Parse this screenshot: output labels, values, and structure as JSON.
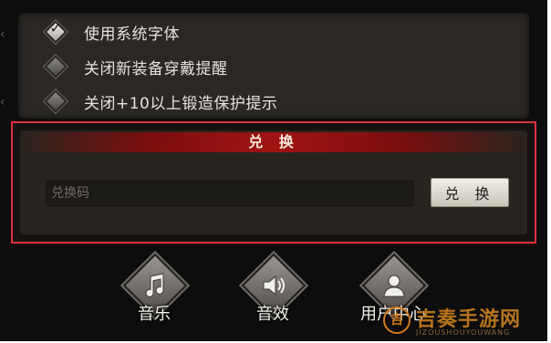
{
  "options": [
    {
      "label": "使用系统字体",
      "checked": true
    },
    {
      "label": "关闭新装备穿戴提醒",
      "checked": false
    },
    {
      "label": "关闭+10以上锻造保护提示",
      "checked": false
    }
  ],
  "redeem": {
    "title": "兑 换",
    "placeholder": "兑换码",
    "button_label": "兑 换",
    "highlight_color": "#e0313f"
  },
  "bottom_menu": [
    {
      "label": "音乐",
      "icon": "music-icon"
    },
    {
      "label": "音效",
      "icon": "speaker-icon"
    },
    {
      "label": "用户中心",
      "icon": "user-icon"
    }
  ],
  "watermark": {
    "text": "吉奏手游网",
    "subtext": "JIZOUSHOUYOUWANG"
  }
}
